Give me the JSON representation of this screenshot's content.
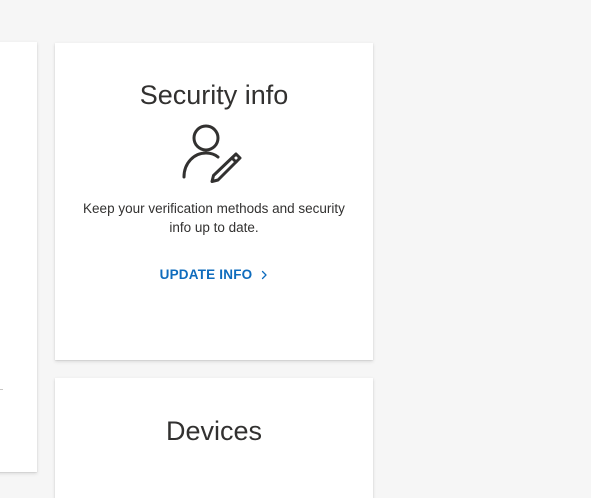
{
  "security_card": {
    "title": "Security info",
    "icon": "user-edit-icon",
    "description": "Keep your verification methods and security info up to date.",
    "link_label": "UPDATE INFO",
    "link_icon": "chevron-right-icon"
  },
  "devices_card": {
    "title": "Devices"
  },
  "colors": {
    "page_background": "#f6f6f6",
    "card_background": "#ffffff",
    "text": "#323130",
    "link": "#0f6cbd"
  }
}
